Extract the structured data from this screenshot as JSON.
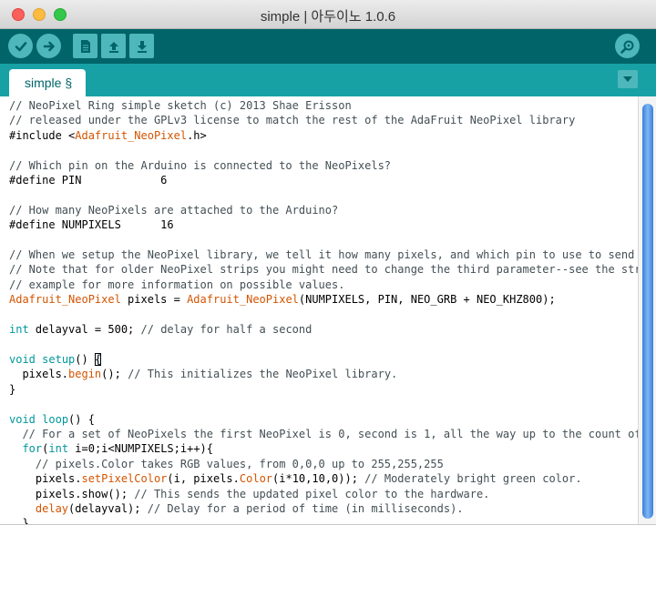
{
  "window": {
    "title": "simple | 아두이노 1.0.6"
  },
  "toolbar": {
    "verify_icon": "check-icon",
    "upload_icon": "arrow-right-icon",
    "new_icon": "document-icon",
    "open_icon": "arrow-up-icon",
    "save_icon": "arrow-down-icon",
    "serial_monitor_icon": "magnifier-icon"
  },
  "tabs": [
    {
      "label": "simple §"
    }
  ],
  "colors": {
    "toolbar": "#006468",
    "tabbar": "#17a1a5",
    "button": "#4db7bb",
    "comment": "#434f54",
    "keyword": "#00979c",
    "library": "#d35400"
  },
  "code_lines": [
    [
      {
        "t": "// NeoPixel Ring simple sketch (c) 2013 Shae Erisson",
        "c": "comment"
      }
    ],
    [
      {
        "t": "// released under the GPLv3 license to match the rest of the AdaFruit NeoPixel library",
        "c": "comment"
      }
    ],
    [
      {
        "t": "#include <",
        "c": "plain"
      },
      {
        "t": "Adafruit_NeoPixel",
        "c": "lib"
      },
      {
        "t": ".h>",
        "c": "plain"
      }
    ],
    [],
    [
      {
        "t": "// Which pin on the Arduino is connected to the NeoPixels?",
        "c": "comment"
      }
    ],
    [
      {
        "t": "#define PIN            6",
        "c": "plain"
      }
    ],
    [],
    [
      {
        "t": "// How many NeoPixels are attached to the Arduino?",
        "c": "comment"
      }
    ],
    [
      {
        "t": "#define NUMPIXELS      16",
        "c": "plain"
      }
    ],
    [],
    [
      {
        "t": "// When we setup the NeoPixel library, we tell it how many pixels, and which pin to use to send si",
        "c": "comment"
      }
    ],
    [
      {
        "t": "// Note that for older NeoPixel strips you might need to change the third parameter--see the stran",
        "c": "comment"
      }
    ],
    [
      {
        "t": "// example for more information on possible values.",
        "c": "comment"
      }
    ],
    [
      {
        "t": "Adafruit_NeoPixel",
        "c": "lib"
      },
      {
        "t": " pixels = ",
        "c": "plain"
      },
      {
        "t": "Adafruit_NeoPixel",
        "c": "lib"
      },
      {
        "t": "(NUMPIXELS, PIN, NEO_GRB + NEO_KHZ800);",
        "c": "plain"
      }
    ],
    [],
    [
      {
        "t": "int",
        "c": "type"
      },
      {
        "t": " delayval = 500; ",
        "c": "plain"
      },
      {
        "t": "// delay for half a second",
        "c": "comment"
      }
    ],
    [],
    [
      {
        "t": "void",
        "c": "type"
      },
      {
        "t": " ",
        "c": "plain"
      },
      {
        "t": "setup",
        "c": "kw"
      },
      {
        "t": "() ",
        "c": "plain"
      },
      {
        "t": "{",
        "c": "cursor"
      }
    ],
    [
      {
        "t": "  pixels.",
        "c": "plain"
      },
      {
        "t": "begin",
        "c": "fn"
      },
      {
        "t": "(); ",
        "c": "plain"
      },
      {
        "t": "// This initializes the NeoPixel library.",
        "c": "comment"
      }
    ],
    [
      {
        "t": "}",
        "c": "plain"
      }
    ],
    [],
    [
      {
        "t": "void",
        "c": "type"
      },
      {
        "t": " ",
        "c": "plain"
      },
      {
        "t": "loop",
        "c": "kw"
      },
      {
        "t": "() {",
        "c": "plain"
      }
    ],
    [
      {
        "t": "  // For a set of NeoPixels the first NeoPixel is 0, second is 1, all the way up to the count of p",
        "c": "comment"
      }
    ],
    [
      {
        "t": "  ",
        "c": "plain"
      },
      {
        "t": "for",
        "c": "kw"
      },
      {
        "t": "(",
        "c": "plain"
      },
      {
        "t": "int",
        "c": "type"
      },
      {
        "t": " i=0;i<NUMPIXELS;i++){",
        "c": "plain"
      }
    ],
    [
      {
        "t": "    // pixels.Color takes RGB values, from 0,0,0 up to 255,255,255",
        "c": "comment"
      }
    ],
    [
      {
        "t": "    pixels.",
        "c": "plain"
      },
      {
        "t": "setPixelColor",
        "c": "fn"
      },
      {
        "t": "(i, pixels.",
        "c": "plain"
      },
      {
        "t": "Color",
        "c": "fn"
      },
      {
        "t": "(i*10,10,0)); ",
        "c": "plain"
      },
      {
        "t": "// Moderately bright green color.",
        "c": "comment"
      }
    ],
    [
      {
        "t": "    pixels.show(); ",
        "c": "plain"
      },
      {
        "t": "// This sends the updated pixel color to the hardware.",
        "c": "comment"
      }
    ],
    [
      {
        "t": "    ",
        "c": "plain"
      },
      {
        "t": "delay",
        "c": "fn"
      },
      {
        "t": "(delayval); ",
        "c": "plain"
      },
      {
        "t": "// Delay for a period of time (in milliseconds).",
        "c": "comment"
      }
    ],
    [
      {
        "t": "  }",
        "c": "plain"
      }
    ],
    [
      {
        "t": "}",
        "c": "plain"
      }
    ]
  ]
}
